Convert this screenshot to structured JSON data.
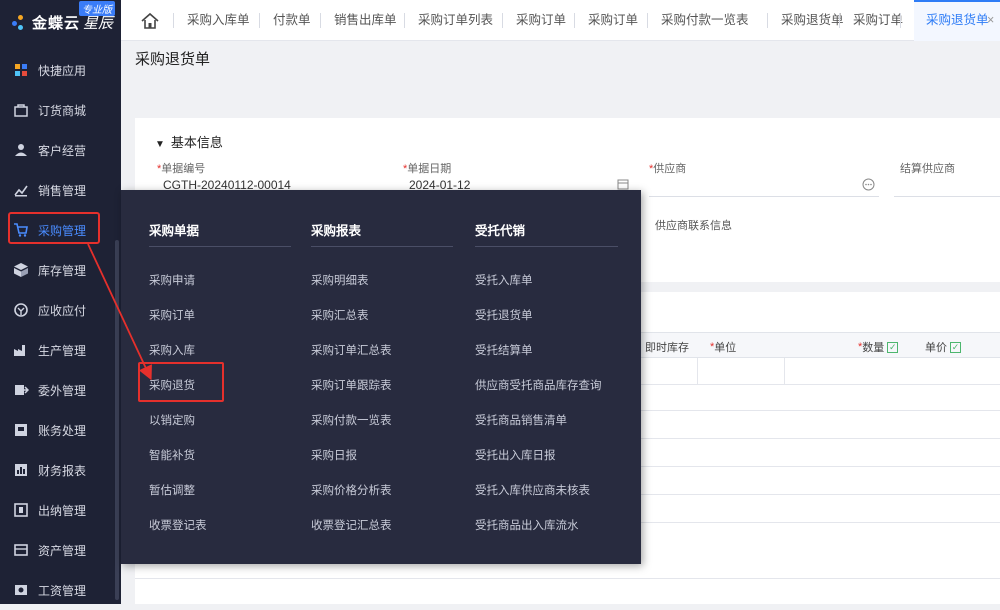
{
  "app": {
    "brand": "金蝶云",
    "brand_sub": "星辰",
    "edition_badge": "专业版"
  },
  "sidebar": {
    "items": [
      {
        "label": "快捷应用",
        "icon": "apps-icon"
      },
      {
        "label": "订货商城",
        "icon": "shop-icon"
      },
      {
        "label": "客户经营",
        "icon": "customer-icon"
      },
      {
        "label": "销售管理",
        "icon": "sales-icon"
      },
      {
        "label": "采购管理",
        "icon": "cart-icon"
      },
      {
        "label": "库存管理",
        "icon": "box-icon"
      },
      {
        "label": "应收应付",
        "icon": "money-icon"
      },
      {
        "label": "生产管理",
        "icon": "factory-icon"
      },
      {
        "label": "委外管理",
        "icon": "outsource-icon"
      },
      {
        "label": "账务处理",
        "icon": "ledger-icon"
      },
      {
        "label": "财务报表",
        "icon": "report-icon"
      },
      {
        "label": "出纳管理",
        "icon": "cashier-icon"
      },
      {
        "label": "资产管理",
        "icon": "asset-icon"
      },
      {
        "label": "工资管理",
        "icon": "salary-icon"
      }
    ]
  },
  "tabs": [
    "采购入库单",
    "付款单",
    "销售出库单",
    "采购订单列表",
    "采购订单",
    "采购订单",
    "采购付款一览表",
    "采购退货单",
    "采购订单",
    "采购退货单"
  ],
  "page": {
    "title": "采购退货单",
    "section": "基本信息",
    "fields": [
      {
        "label": "单据编号",
        "required": "*",
        "value": "CGTH-20240112-00014"
      },
      {
        "label": "单据日期",
        "required": "*",
        "value": "2024-01-12"
      },
      {
        "label": "供应商",
        "required": "*",
        "value": ""
      },
      {
        "label": "结算供应商",
        "required": "",
        "value": ""
      }
    ],
    "supplier_contact_label": "供应商联系信息",
    "grid_headers": [
      {
        "label": "即时库存",
        "required": ""
      },
      {
        "label": "单位",
        "required": "*"
      },
      {
        "label": "数量",
        "required": "*"
      },
      {
        "label": "单价",
        "required": ""
      }
    ],
    "check_glyph": "✓"
  },
  "flyout": {
    "columns": [
      {
        "title": "采购单据",
        "items": [
          "采购申请",
          "采购订单",
          "采购入库",
          "采购退货",
          "以销定购",
          "智能补货",
          "暂估调整",
          "收票登记表"
        ]
      },
      {
        "title": "采购报表",
        "items": [
          "采购明细表",
          "采购汇总表",
          "采购订单汇总表",
          "采购订单跟踪表",
          "采购付款一览表",
          "采购日报",
          "采购价格分析表",
          "收票登记汇总表"
        ]
      },
      {
        "title": "受托代销",
        "items": [
          "受托入库单",
          "受托退货单",
          "受托结算单",
          "供应商受托商品库存查询",
          "受托商品销售清单",
          "受托出入库日报",
          "受托入库供应商未核表",
          "受托商品出入库流水"
        ]
      }
    ]
  },
  "colors": {
    "accent": "#2e7cf6",
    "annotation": "#e5302c",
    "sidebar_bg": "#1e2235",
    "flyout_bg": "#282b3f"
  }
}
